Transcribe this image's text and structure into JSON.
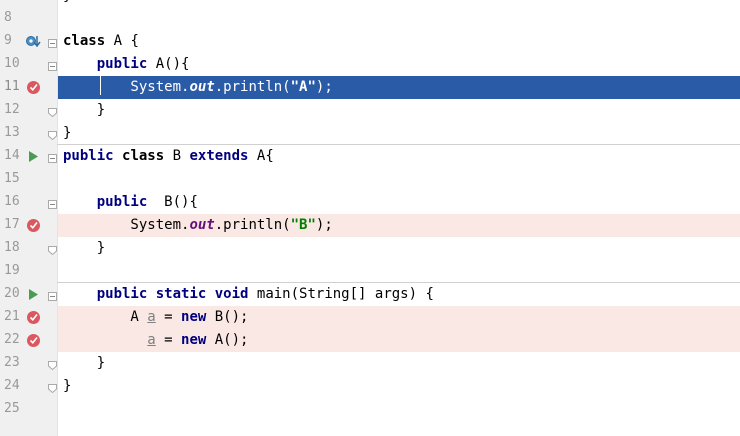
{
  "editor": {
    "top_partial": "}",
    "lines": [
      {
        "num": "8",
        "code": ""
      },
      {
        "num": "9",
        "code": "class A {"
      },
      {
        "num": "10",
        "code": "    public A(){"
      },
      {
        "num": "11",
        "code": "        System.out.println(\"A\");"
      },
      {
        "num": "12",
        "code": "    }"
      },
      {
        "num": "13",
        "code": "}"
      },
      {
        "num": "14",
        "code": "public class B extends A{"
      },
      {
        "num": "15",
        "code": ""
      },
      {
        "num": "16",
        "code": "    public  B(){"
      },
      {
        "num": "17",
        "code": "        System.out.println(\"B\");"
      },
      {
        "num": "18",
        "code": "    }"
      },
      {
        "num": "19",
        "code": ""
      },
      {
        "num": "20",
        "code": "    public static void main(String[] args) {"
      },
      {
        "num": "21",
        "code": "        A a = new B();"
      },
      {
        "num": "22",
        "code": "          a = new A();"
      },
      {
        "num": "23",
        "code": "    }"
      },
      {
        "num": "24",
        "code": "}"
      },
      {
        "num": "25",
        "code": ""
      }
    ]
  },
  "colors": {
    "selection": "#2a5ba7",
    "breakpoint_line": "#fae8e4",
    "breakpoint": "#db5860",
    "run_arrow": "#499c54",
    "keyword": "#000080",
    "static_field": "#660e7a",
    "string": "#008000"
  },
  "icons": {
    "line_9": "override-arrow-icon",
    "breakpoints": [
      "line-11",
      "line-17",
      "line-21",
      "line-22"
    ],
    "run": [
      "line-14",
      "line-20"
    ]
  }
}
